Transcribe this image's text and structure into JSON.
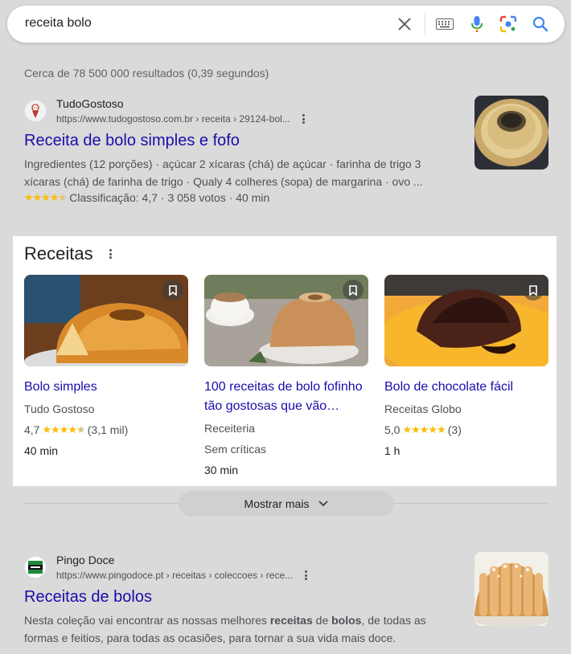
{
  "search": {
    "query": "receita bolo"
  },
  "icons": {
    "clear": "close-icon",
    "keyboard": "keyboard-icon",
    "voice": "microphone-icon",
    "lens": "lens-icon",
    "search": "search-icon"
  },
  "stats": "Cerca de 78 500 000 resultados (0,39 segundos)",
  "result1": {
    "site": "TudoGostoso",
    "url": "https://www.tudogostoso.com.br › receita › 29124-bol...",
    "title": "Receita de bolo simples e fofo",
    "snippet_line1": "Ingredientes (12 porções) · açúcar 2 xícaras (chá) de açúcar · farinha de trigo 3",
    "snippet_line2": "xícaras (chá) de farinha de trigo · Qualy 4 colheres (sopa) de margarina · ovo ...",
    "rating_stars": 4.5,
    "rating_text": "Classificação: 4,7 · 3 058 votos · 40 min"
  },
  "recipes": {
    "title": "Receitas",
    "cards": [
      {
        "title": "Bolo simples",
        "source": "Tudo Gostoso",
        "rating": "4,7",
        "stars": 4.5,
        "count": "(3,1 mil)",
        "time": "40 min"
      },
      {
        "title_line1": "100 receitas de bolo fofinho",
        "title_line2": "tão gostosas que vão…",
        "source": "Receiteria",
        "reviews": "Sem críticas",
        "time": "30 min"
      },
      {
        "title": "Bolo de chocolate fácil",
        "source": "Receitas Globo",
        "rating": "5,0",
        "stars": 5,
        "count": "(3)",
        "time": "1 h"
      }
    ]
  },
  "show_more": "Mostrar mais",
  "result2": {
    "site": "Pingo Doce",
    "url": "https://www.pingodoce.pt › receitas › coleccoes › rece...",
    "title": "Receitas de bolos",
    "snippet_line1_a": "Nesta coleção vai encontrar as nossas melhores ",
    "snippet_line1_b": "receitas",
    "snippet_line1_c": " de ",
    "snippet_line1_d": "bolos",
    "snippet_line1_e": ", de todas as",
    "snippet_line2": "formas e feitios, para todas as ocasiões, para tornar a sua vida mais doce."
  },
  "colors": {
    "link": "#1a0dab",
    "star": "#fbbc04",
    "background": "#dadada"
  }
}
